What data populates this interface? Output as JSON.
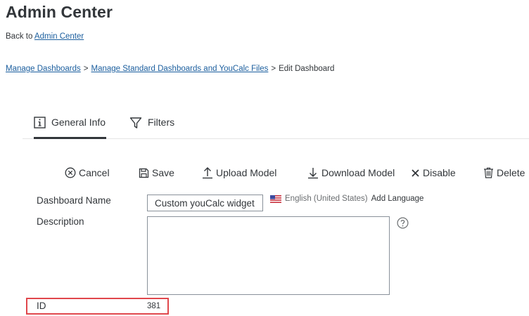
{
  "page": {
    "title": "Admin Center"
  },
  "back": {
    "prefix": "Back to",
    "link": "Admin Center"
  },
  "breadcrumb": {
    "items": [
      "Manage Dashboards",
      "Manage Standard Dashboards and YouCalc Files"
    ],
    "separator": ">",
    "current": "Edit Dashboard"
  },
  "tabs": [
    {
      "label": "General Info",
      "icon": "info-icon",
      "active": true
    },
    {
      "label": "Filters",
      "icon": "filter-icon",
      "active": false
    }
  ],
  "toolbar": {
    "cancel": "Cancel",
    "save": "Save",
    "upload": "Upload Model",
    "download": "Download Model",
    "disable": "Disable",
    "delete": "Delete"
  },
  "form": {
    "name_label": "Dashboard Name",
    "name_value": "Custom youCalc widget",
    "language": "English (United States)",
    "add_language": "Add Language",
    "description_label": "Description",
    "description_value": "",
    "id_label": "ID",
    "id_value": "381"
  },
  "colors": {
    "link": "#1b5e9e",
    "highlight": "#e0474c",
    "text": "#32363a"
  }
}
